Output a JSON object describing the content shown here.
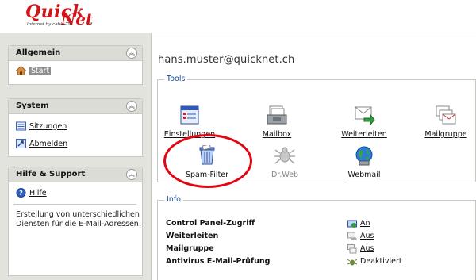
{
  "brand": {
    "logo_word1": "Quick",
    "logo_word2": "Net",
    "tagline": "Internet by cable-TV"
  },
  "sidebar": {
    "sections": [
      {
        "title": "Allgemein",
        "items": [
          {
            "label": "Start",
            "icon": "home-icon",
            "selected": true
          }
        ]
      },
      {
        "title": "System",
        "items": [
          {
            "label": "Sitzungen",
            "icon": "sessions-icon"
          },
          {
            "label": "Abmelden",
            "icon": "logout-icon"
          }
        ]
      },
      {
        "title": "Hilfe & Support",
        "items": [
          {
            "label": "Hilfe",
            "icon": "help-icon"
          }
        ],
        "description": "Erstellung von unterschiedlichen Diensten für die E-Mail-Adressen."
      }
    ]
  },
  "main": {
    "account": "hans.muster@quicknet.ch",
    "tools": {
      "legend": "Tools",
      "items": [
        {
          "label": "Einstellungen",
          "icon": "settings-icon"
        },
        {
          "label": "Mailbox",
          "icon": "mailbox-icon"
        },
        {
          "label": "Weiterleiten",
          "icon": "forward-icon"
        },
        {
          "label": "Mailgruppe",
          "icon": "mailgroup-icon"
        },
        {
          "label": "Spam-Filter",
          "icon": "spam-filter-icon",
          "highlighted": true
        },
        {
          "label": "Dr.Web",
          "icon": "drweb-icon",
          "disabled": true
        },
        {
          "label": "Webmail",
          "icon": "webmail-icon"
        }
      ]
    },
    "info": {
      "legend": "Info",
      "rows": [
        {
          "key": "Control Panel-Zugriff",
          "value": "An",
          "icon": "access-icon"
        },
        {
          "key": "Weiterleiten",
          "value": "Aus",
          "icon": "forward-status-icon"
        },
        {
          "key": "Mailgruppe",
          "value": "Aus",
          "icon": "mailgroup-status-icon"
        },
        {
          "key": "Antivirus E-Mail-Prüfung",
          "value": "Deaktiviert",
          "icon": "antivirus-icon"
        }
      ]
    }
  },
  "colors": {
    "logo_red": "#d0141a",
    "legend_blue": "#1b4a9b",
    "highlight_circle": "#e30613"
  }
}
